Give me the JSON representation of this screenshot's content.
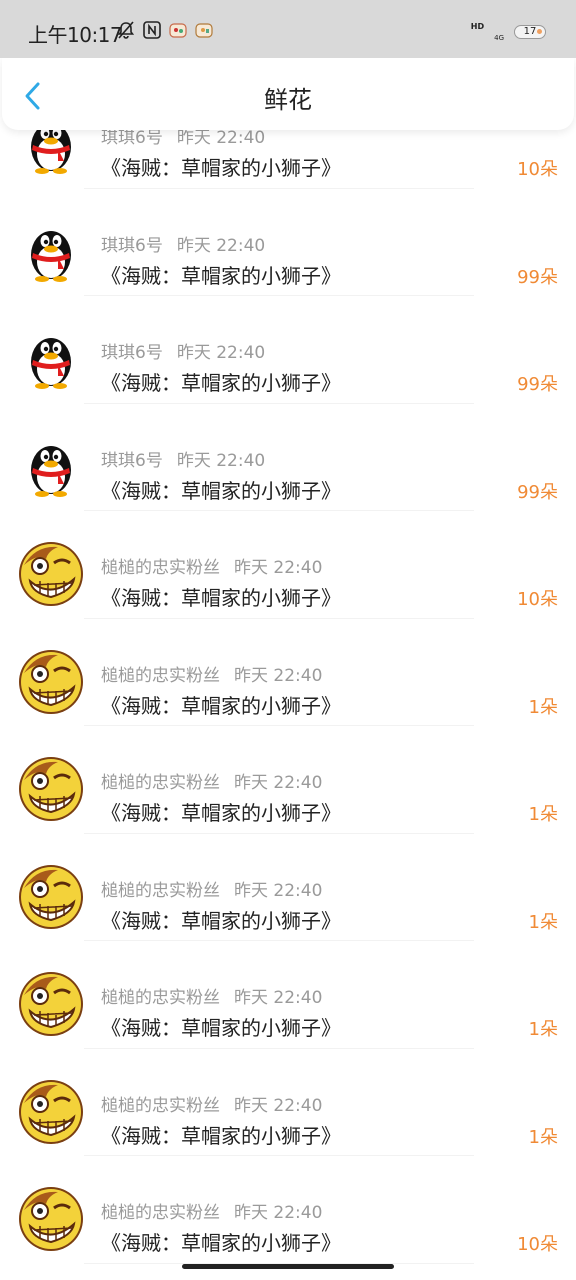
{
  "status_bar": {
    "time": "上午10:17",
    "network_label": "HD",
    "signal_label": "4G",
    "battery_level": "17",
    "icons": [
      "bell-off-icon",
      "nfc-icon",
      "app-badge-icon",
      "app-badge-icon"
    ]
  },
  "header": {
    "title": "鲜花",
    "back_icon": "chevron-left-icon"
  },
  "colors": {
    "accent": "#2fa9e6",
    "amount": "#f08a35",
    "meta_text": "#9a9a9a",
    "status_bar_bg": "#d9d9d9"
  },
  "list": {
    "items": [
      {
        "avatar": "penguin",
        "name": "琪琪6号",
        "time": "昨天 22:40",
        "work": "《海贼：草帽家的小狮子》",
        "amount": "10朵"
      },
      {
        "avatar": "penguin",
        "name": "琪琪6号",
        "time": "昨天 22:40",
        "work": "《海贼：草帽家的小狮子》",
        "amount": "99朵"
      },
      {
        "avatar": "penguin",
        "name": "琪琪6号",
        "time": "昨天 22:40",
        "work": "《海贼：草帽家的小狮子》",
        "amount": "99朵"
      },
      {
        "avatar": "penguin",
        "name": "琪琪6号",
        "time": "昨天 22:40",
        "work": "《海贼：草帽家的小狮子》",
        "amount": "99朵"
      },
      {
        "avatar": "grin",
        "name": "槌槌的忠实粉丝",
        "time": "昨天 22:40",
        "work": "《海贼：草帽家的小狮子》",
        "amount": "10朵"
      },
      {
        "avatar": "grin",
        "name": "槌槌的忠实粉丝",
        "time": "昨天 22:40",
        "work": "《海贼：草帽家的小狮子》",
        "amount": "1朵"
      },
      {
        "avatar": "grin",
        "name": "槌槌的忠实粉丝",
        "time": "昨天 22:40",
        "work": "《海贼：草帽家的小狮子》",
        "amount": "1朵"
      },
      {
        "avatar": "grin",
        "name": "槌槌的忠实粉丝",
        "time": "昨天 22:40",
        "work": "《海贼：草帽家的小狮子》",
        "amount": "1朵"
      },
      {
        "avatar": "grin",
        "name": "槌槌的忠实粉丝",
        "time": "昨天 22:40",
        "work": "《海贼：草帽家的小狮子》",
        "amount": "1朵"
      },
      {
        "avatar": "grin",
        "name": "槌槌的忠实粉丝",
        "time": "昨天 22:40",
        "work": "《海贼：草帽家的小狮子》",
        "amount": "1朵"
      },
      {
        "avatar": "grin",
        "name": "槌槌的忠实粉丝",
        "time": "昨天 22:40",
        "work": "《海贼：草帽家的小狮子》",
        "amount": "10朵"
      }
    ]
  }
}
